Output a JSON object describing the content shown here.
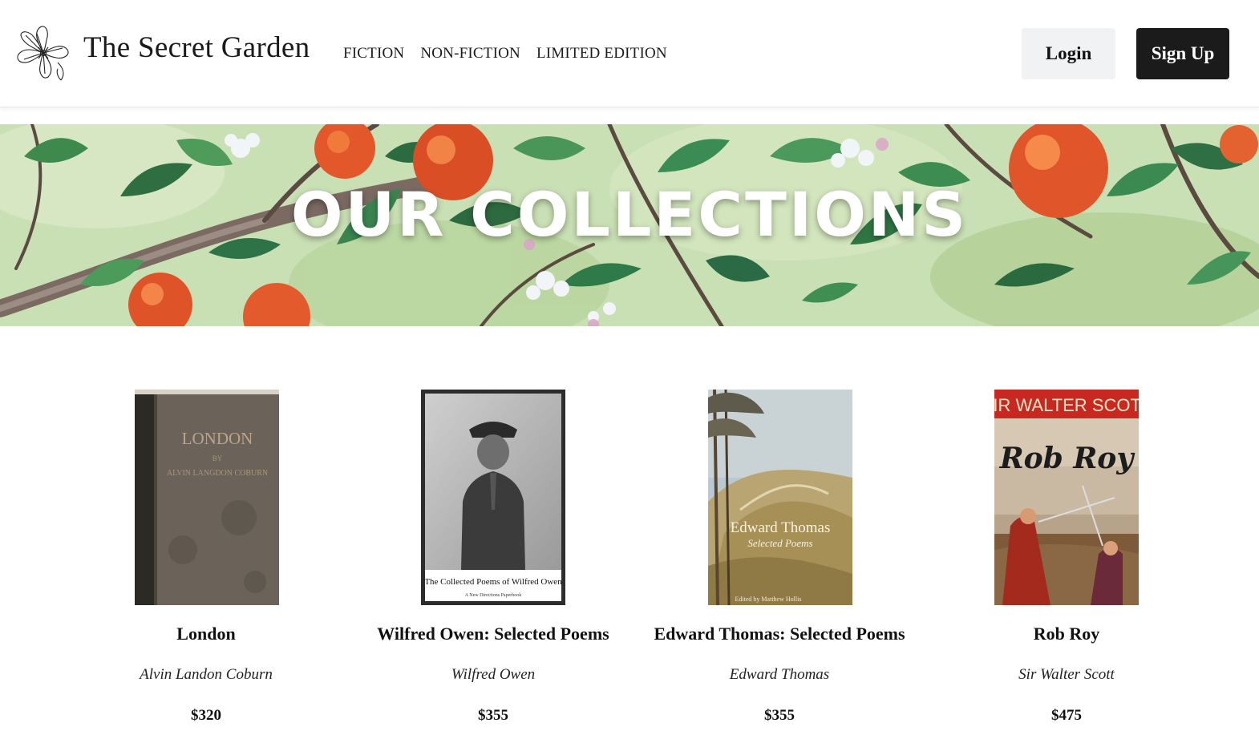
{
  "brand": {
    "name": "The Secret Garden",
    "logo_icon": "flower-icon"
  },
  "nav": {
    "items": [
      "FICTION",
      "NON-FICTION",
      "LIMITED EDITION"
    ]
  },
  "auth": {
    "login_label": "Login",
    "signup_label": "Sign Up"
  },
  "hero": {
    "title": "OUR COLLECTIONS"
  },
  "covers": {
    "london": {
      "title": "LONDON",
      "by": "BY",
      "author": "ALVIN LANGDON COBURN"
    },
    "owen": {
      "caption": "The Collected Poems of Wilfred Owen",
      "subcaption": "A New Directions Paperbook"
    },
    "thomas": {
      "name": "Edward Thomas",
      "subtitle": "Selected Poems",
      "editor": "Edited by Matthew Hollis"
    },
    "robroy": {
      "author": "SIR WALTER SCOTT",
      "title": "Rob Roy"
    }
  },
  "products": [
    {
      "title": "London",
      "author": "Alvin Landon Coburn",
      "price": "$320"
    },
    {
      "title": "Wilfred Owen: Selected Poems",
      "author": "Wilfred Owen",
      "price": "$355"
    },
    {
      "title": "Edward Thomas: Selected Poems",
      "author": "Edward Thomas",
      "price": "$355"
    },
    {
      "title": "Rob Roy",
      "author": "Sir Walter Scott",
      "price": "$475"
    }
  ],
  "colors": {
    "signup_bg": "#1b1b1b",
    "login_bg": "#f1f2f4",
    "hero_leaf_green": "#3f8a4a",
    "hero_orange": "#e2582a"
  }
}
